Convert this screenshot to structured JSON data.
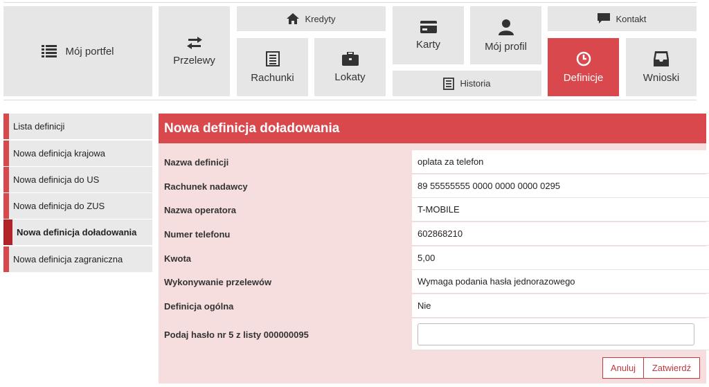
{
  "nav": {
    "wallet": "Mój portfel",
    "transfers": "Przelewy",
    "credits": "Kredyty",
    "accounts": "Rachunki",
    "deposits": "Lokaty",
    "cards": "Karty",
    "history": "Historia",
    "profile": "Mój profil",
    "contact": "Kontakt",
    "definitions": "Definicje",
    "applications": "Wnioski"
  },
  "sidebar": {
    "items": [
      {
        "label": "Lista definicji"
      },
      {
        "label": "Nowa definicja krajowa"
      },
      {
        "label": "Nowa definicja do US"
      },
      {
        "label": "Nowa definicja do ZUS"
      },
      {
        "label": "Nowa definicja doładowania"
      },
      {
        "label": "Nowa definicja zagraniczna"
      }
    ]
  },
  "form": {
    "title": "Nowa definicja doładowania",
    "fields": [
      {
        "label": "Nazwa definicji",
        "value": "oplata za telefon"
      },
      {
        "label": "Rachunek nadawcy",
        "value": "89 55555555 0000 0000 0000 0295"
      },
      {
        "label": "Nazwa operatora",
        "value": "T-MOBILE"
      },
      {
        "label": "Numer telefonu",
        "value": "602868210"
      },
      {
        "label": "Kwota",
        "value": "5,00"
      },
      {
        "label": "Wykonywanie przelewów",
        "value": "Wymaga podania hasła jednorazowego"
      },
      {
        "label": "Definicja ogólna",
        "value": "Nie"
      }
    ],
    "password_label": "Podaj hasło nr 5 z listy 000000095",
    "password_value": "",
    "cancel": "Anuluj",
    "confirm": "Zatwierdź"
  },
  "colors": {
    "accent": "#d9484c",
    "accent_dark": "#b02428",
    "tile_bg": "#e6e6e6",
    "panel_bg": "#f6dede"
  }
}
